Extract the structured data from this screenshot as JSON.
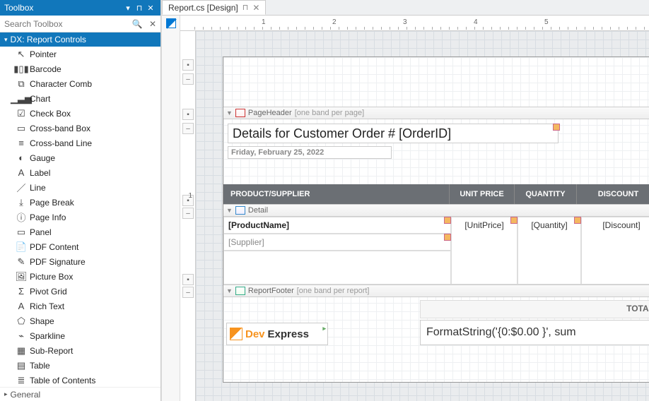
{
  "toolbox": {
    "title": "Toolbox",
    "search_placeholder": "Search Toolbox",
    "category_label": "DX: Report Controls",
    "items": [
      {
        "key": "pointer",
        "label": "Pointer"
      },
      {
        "key": "barcode",
        "label": "Barcode"
      },
      {
        "key": "character-comb",
        "label": "Character Comb"
      },
      {
        "key": "chart",
        "label": "Chart"
      },
      {
        "key": "check-box",
        "label": "Check Box"
      },
      {
        "key": "cross-band-box",
        "label": "Cross-band Box"
      },
      {
        "key": "cross-band-line",
        "label": "Cross-band Line"
      },
      {
        "key": "gauge",
        "label": "Gauge"
      },
      {
        "key": "label",
        "label": "Label"
      },
      {
        "key": "line",
        "label": "Line"
      },
      {
        "key": "page-break",
        "label": "Page Break"
      },
      {
        "key": "page-info",
        "label": "Page Info"
      },
      {
        "key": "panel",
        "label": "Panel"
      },
      {
        "key": "pdf-content",
        "label": "PDF Content"
      },
      {
        "key": "pdf-signature",
        "label": "PDF Signature"
      },
      {
        "key": "picture-box",
        "label": "Picture Box"
      },
      {
        "key": "pivot-grid",
        "label": "Pivot Grid"
      },
      {
        "key": "rich-text",
        "label": "Rich Text"
      },
      {
        "key": "shape",
        "label": "Shape"
      },
      {
        "key": "sparkline",
        "label": "Sparkline"
      },
      {
        "key": "sub-report",
        "label": "Sub-Report"
      },
      {
        "key": "table",
        "label": "Table"
      },
      {
        "key": "table-of-contents",
        "label": "Table of Contents"
      }
    ],
    "general_label": "General"
  },
  "tabs": {
    "active": "Report.cs [Design]"
  },
  "ruler": {
    "top_numbers": [
      "1",
      "2",
      "3",
      "4",
      "5"
    ],
    "left_numbers": [
      "1"
    ]
  },
  "bands": {
    "page_header": {
      "label": "PageHeader",
      "hint": "[one band per page]"
    },
    "detail": {
      "label": "Detail"
    },
    "report_footer": {
      "label": "ReportFooter",
      "hint": "[one band per report]"
    }
  },
  "page_header_content": {
    "title_expr": "Details for Customer Order # [OrderID]",
    "date_text": "Friday, February 25, 2022",
    "columns": {
      "product_supplier": "PRODUCT/SUPPLIER",
      "unit_price": "UNIT PRICE",
      "quantity": "QUANTITY",
      "discount": "DISCOUNT"
    }
  },
  "detail_content": {
    "product_name": "[ProductName]",
    "supplier": "[Supplier]",
    "unit_price": "[UnitPrice]",
    "quantity": "[Quantity]",
    "discount": "[Discount]"
  },
  "report_footer_content": {
    "logo_dev": "Dev",
    "logo_express": "Express",
    "total_label": "TOTAL",
    "format_expr": "FormatString('{0:$0.00 }', sum"
  }
}
